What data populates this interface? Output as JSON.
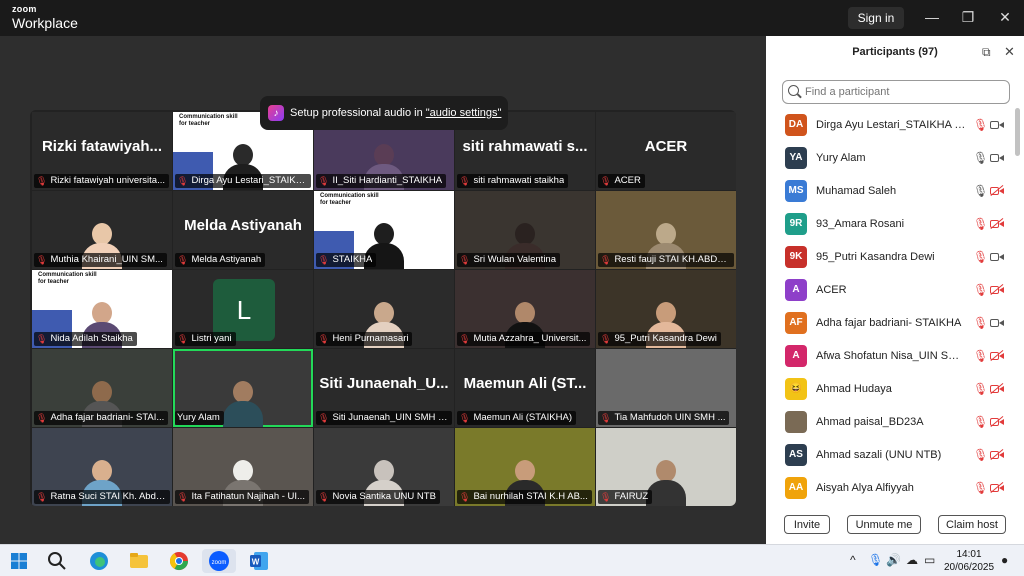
{
  "app": {
    "brand_top": "zoom",
    "brand_bottom": "Workplace",
    "signin_label": "Sign in"
  },
  "window_controls": {
    "minimize": "—",
    "maximize": "❐",
    "close": "✕"
  },
  "toast": {
    "text": "Setup professional audio in",
    "link": "\"audio settings\""
  },
  "banner_text": {
    "line1": "Communication skill",
    "line2": "for teacher"
  },
  "tiles": [
    {
      "big": "Rizki  fatawiyah...",
      "label": "Rizki fatawiyah universita..."
    },
    {
      "label": "Dirga Ayu Lestari_STAIKHA"
    },
    {
      "label": "II_Siti Hardianti_STAIKHA"
    },
    {
      "big": "siti  rahmawati  s...",
      "label": "siti rahmawati staikha"
    },
    {
      "big": "ACER",
      "label": "ACER"
    },
    {
      "label": "Muthia Khairani_UIN SM..."
    },
    {
      "big": "Melda  Astiyanah",
      "label": "Melda Astiyanah"
    },
    {
      "label": "STAIKHA"
    },
    {
      "label": "Sri Wulan Valentina"
    },
    {
      "label": "Resti fauji STAI KH.ABDUL..."
    },
    {
      "label": "Nida Adilah Staikha"
    },
    {
      "letter": "L",
      "label": "Listri yani"
    },
    {
      "label": "Heni Purnamasari"
    },
    {
      "label": "Mutia Azzahra_ Universit..."
    },
    {
      "label": "95_Putri Kasandra Dewi"
    },
    {
      "label": "Adha fajar badriani- STAI..."
    },
    {
      "label": "Yury Alam"
    },
    {
      "big": "Siti  Junaenah_U...",
      "label": "Siti Junaenah_UIN SMH B..."
    },
    {
      "big": "Maemun  Ali  (ST...",
      "label": "Maemun Ali (STAIKHA)"
    },
    {
      "label": "Tia Mahfudoh UIN SMH ..."
    },
    {
      "label": "Ratna Suci STAI Kh. Abdul..."
    },
    {
      "label": "Ita Fatihatun Najihah - UI..."
    },
    {
      "label": "Novia Santika UNU NTB"
    },
    {
      "label": "Bai nurhilah STAI K.H AB..."
    },
    {
      "label": "FAIRUZ"
    }
  ],
  "panel": {
    "title": "Participants (97)",
    "search_placeholder": "Find a participant",
    "participants": [
      {
        "initials": "DA",
        "color": "#d0541c",
        "name": "Dirga Ayu Lestari_STAIKHA (Me)",
        "muted": true,
        "video": true
      },
      {
        "initials": "YA",
        "color": "#2d3e50",
        "name": "Yury Alam",
        "muted": false,
        "video": true
      },
      {
        "initials": "MS",
        "color": "#3a7bd5",
        "name": "Muhamad Saleh",
        "muted": false,
        "video": false
      },
      {
        "initials": "9R",
        "color": "#1f9e8a",
        "name": "93_Amara Rosani",
        "muted": true,
        "video": false
      },
      {
        "initials": "9K",
        "color": "#c7302a",
        "name": "95_Putri Kasandra Dewi",
        "muted": true,
        "video": true
      },
      {
        "initials": "A",
        "color": "#8e3fc9",
        "name": "ACER",
        "muted": true,
        "video": false
      },
      {
        "initials": "AF",
        "color": "#e0701f",
        "name": "Adha fajar badriani- STAIKHA",
        "muted": true,
        "video": true
      },
      {
        "initials": "A",
        "color": "#d3276a",
        "name": "Afwa Shofatun Nisa_UIN SMH B...",
        "muted": true,
        "video": false
      },
      {
        "initials": "😆",
        "color": "#f2c316",
        "name": "Ahmad Hudaya",
        "muted": true,
        "video": false
      },
      {
        "initials": "",
        "color": "#7a6a55",
        "name": "Ahmad paisal_BD23A",
        "muted": true,
        "video": false
      },
      {
        "initials": "AS",
        "color": "#2d3e50",
        "name": "Ahmad sazali (UNU NTB)",
        "muted": true,
        "video": false
      },
      {
        "initials": "AA",
        "color": "#f0a30a",
        "name": "Aisyah Alya Alfiyyah",
        "muted": true,
        "video": false
      }
    ],
    "buttons": {
      "invite": "Invite",
      "unmute": "Unmute me",
      "claim": "Claim host"
    }
  },
  "taskbar": {
    "time": "14:01",
    "date": "20/06/2025"
  }
}
